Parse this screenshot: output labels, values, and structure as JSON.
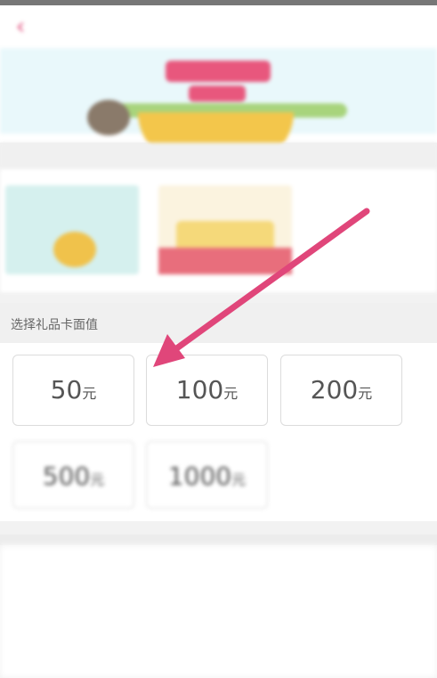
{
  "header": {
    "back_icon": "back-arrow-icon",
    "banner_title": "",
    "accent_color": "#e8577d"
  },
  "sections": {
    "cards_label": "",
    "denomination_label": "选择礼品卡面值"
  },
  "denominations": [
    {
      "amount": "50",
      "unit": "元"
    },
    {
      "amount": "100",
      "unit": "元"
    },
    {
      "amount": "200",
      "unit": "元"
    },
    {
      "amount": "500",
      "unit": "元"
    },
    {
      "amount": "1000",
      "unit": "元"
    }
  ],
  "info": {
    "rows": [
      {
        "label": "",
        "value": ""
      },
      {
        "label": "",
        "value": ""
      }
    ]
  },
  "annotation": {
    "arrow_color": "#e0467a"
  }
}
